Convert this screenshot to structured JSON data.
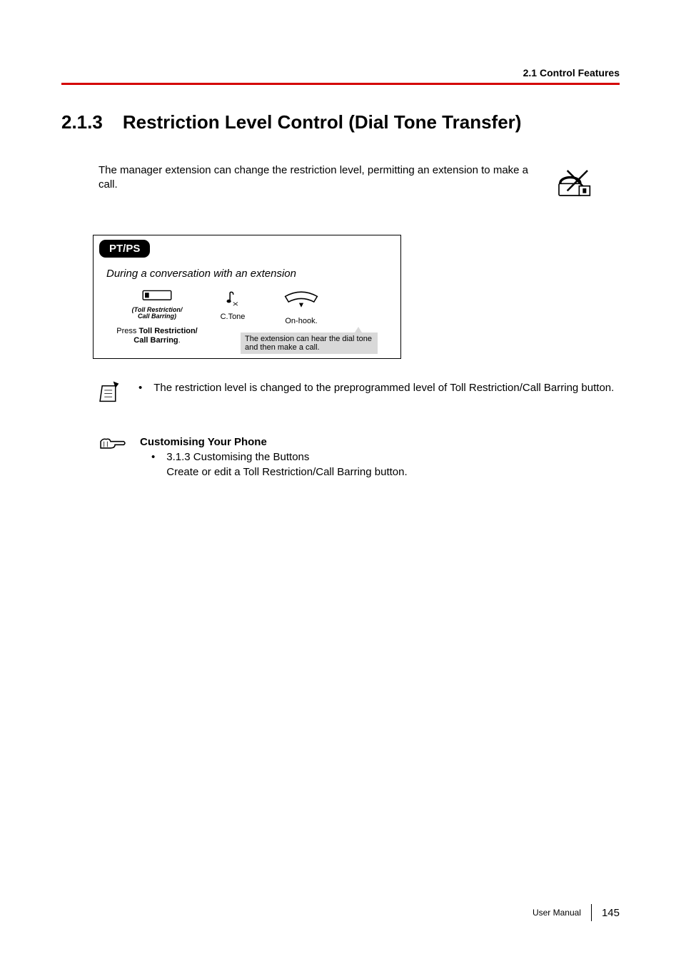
{
  "header": {
    "running": "2.1 Control Features"
  },
  "heading": {
    "number": "2.1.3",
    "title": "Restriction Level Control (Dial Tone Transfer)"
  },
  "intro": {
    "text": "The manager extension can change the restriction level, permitting an extension to make a call."
  },
  "card": {
    "pill": "PT/PS",
    "subtitle": "During a conversation with an extension",
    "step1": {
      "iconLabel": "(Toll Restriction/\nCall Barring)",
      "caption_pre": "Press ",
      "caption_bold": "Toll Restriction/ Call Barring",
      "caption_post": "."
    },
    "step2": {
      "label": "C.Tone"
    },
    "step3": {
      "label": "On-hook."
    },
    "callout": "The extension can hear the dial tone and then make a call."
  },
  "note": {
    "text": "The restriction level is changed to the preprogrammed level of Toll Restriction/Call Barring button."
  },
  "customising": {
    "title": "Customising Your Phone",
    "item": "3.1.3 Customising the Buttons",
    "desc": "Create or edit a Toll Restriction/Call Barring button."
  },
  "footer": {
    "label": "User Manual",
    "page": "145"
  }
}
